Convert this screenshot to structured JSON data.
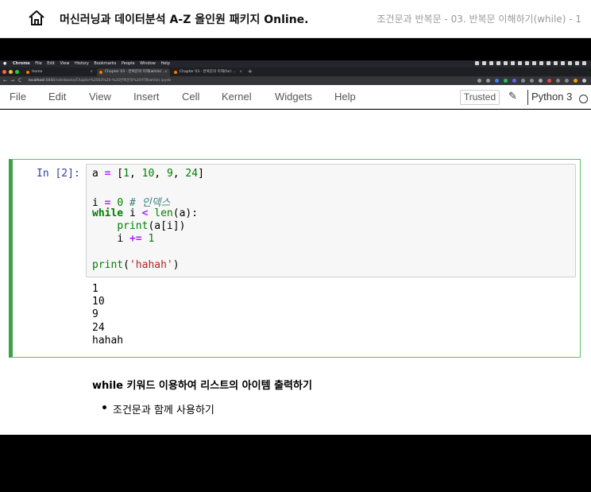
{
  "course": {
    "title": "머신러닝과 데이터분석 A-Z 올인원 패키지 Online.",
    "lecture": "조건문과 반복문 - 03. 반복문 이해하기(while) - 1"
  },
  "mac_menu": {
    "app": "Chrome",
    "items": [
      "File",
      "Edit",
      "View",
      "History",
      "Bookmarks",
      "People",
      "Window",
      "Help"
    ]
  },
  "browser": {
    "tabs": [
      {
        "title": "Home",
        "active": false
      },
      {
        "title": "Chapter 03 - 반복문의 이해(while) ...",
        "active": true
      },
      {
        "title": "Chapter 03 - 반복문의 이해(for) ...",
        "active": false
      }
    ],
    "new_tab": "+",
    "url_host": "localhost",
    "url_rest": ":8888/notebooks/Chapter%2003%20-%20반복문의%20이해(while).ipynb"
  },
  "jupyter": {
    "menu": [
      "File",
      "Edit",
      "View",
      "Insert",
      "Cell",
      "Kernel",
      "Widgets",
      "Help"
    ],
    "trusted": "Trusted",
    "kernel": "Python 3"
  },
  "cell": {
    "prompt": "In [2]:",
    "code": {
      "l1": {
        "a": "a",
        "eq": "=",
        "rest": " [",
        "n1": "1",
        "c1": ", ",
        "n2": "10",
        "c2": ", ",
        "n3": "9",
        "c3": ", ",
        "n4": "24",
        "end": "]"
      },
      "l2": {
        "i": "i",
        "eq": "=",
        "zero": "0",
        "comment": "# 인덱스"
      },
      "l3": {
        "kw": "while",
        "i": " i ",
        "lt": "<",
        "fn": "len",
        "rest": "(a):"
      },
      "l4": {
        "fn": "print",
        "rest": "(a[i])"
      },
      "l5": {
        "i": "i",
        "op": "+=",
        "one": "1"
      },
      "l6": {
        "fn": "print",
        "open": "(",
        "str": "'hahah'",
        "close": ")"
      }
    },
    "outputs": [
      "1",
      "10",
      "9",
      "24",
      "hahah"
    ]
  },
  "markdown": {
    "heading": "while 키워드 이용하여 리스트의 아이템 출력하기",
    "bullet": "조건문과 함께 사용하기"
  },
  "colors": {
    "cell_border": "#42a047",
    "prompt": "#303f9f",
    "keyword": "#008000",
    "operator": "#aa22ff",
    "string": "#ba2121",
    "comment": "#408080"
  }
}
